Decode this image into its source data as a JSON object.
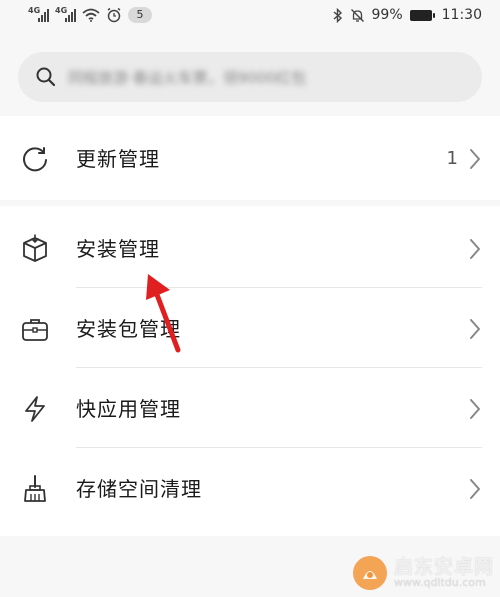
{
  "status_bar": {
    "network_tag_1": "4G",
    "network_tag_2": "4G",
    "notification_count": "5",
    "battery_percent": "99%",
    "time": "11:30"
  },
  "search": {
    "placeholder": "同程旅游·春运火车票，领9000红包"
  },
  "menu_top": [
    {
      "label": "更新管理",
      "count": "1",
      "icon": "refresh-icon"
    }
  ],
  "menu_main": [
    {
      "label": "安装管理",
      "icon": "box-icon"
    },
    {
      "label": "安装包管理",
      "icon": "briefcase-icon"
    },
    {
      "label": "快应用管理",
      "icon": "lightning-icon"
    },
    {
      "label": "存储空间清理",
      "icon": "broom-icon"
    }
  ],
  "watermark": {
    "title": "启东安卓网",
    "url": "www.qdltdu.com"
  },
  "colors": {
    "background": "#f7f7f7",
    "card": "#ffffff",
    "search_bg": "#ebebeb",
    "annotation_arrow": "#e02020",
    "watermark_logo": "#f28b24"
  }
}
